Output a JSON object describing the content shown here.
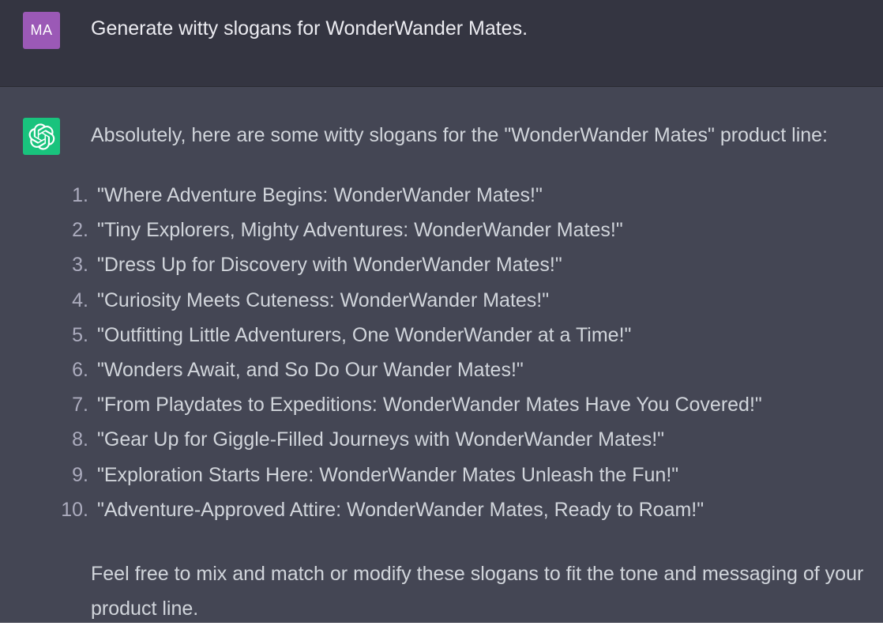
{
  "user_message": {
    "avatar_initials": "MA",
    "text": "Generate witty slogans for WonderWander Mates."
  },
  "assistant_message": {
    "avatar_icon": "openai-logo-icon",
    "intro": "Absolutely, here are some witty slogans for the \"WonderWander Mates\" product line:",
    "slogans": [
      {
        "num": "1.",
        "text": "\"Where Adventure Begins: WonderWander Mates!\""
      },
      {
        "num": "2.",
        "text": "\"Tiny Explorers, Mighty Adventures: WonderWander Mates!\""
      },
      {
        "num": "3.",
        "text": "\"Dress Up for Discovery with WonderWander Mates!\""
      },
      {
        "num": "4.",
        "text": "\"Curiosity Meets Cuteness: WonderWander Mates!\""
      },
      {
        "num": "5.",
        "text": "\"Outfitting Little Adventurers, One WonderWander at a Time!\""
      },
      {
        "num": "6.",
        "text": "\"Wonders Await, and So Do Our Wander Mates!\""
      },
      {
        "num": "7.",
        "text": "\"From Playdates to Expeditions: WonderWander Mates Have You Covered!\""
      },
      {
        "num": "8.",
        "text": "\"Gear Up for Giggle-Filled Journeys with WonderWander Mates!\""
      },
      {
        "num": "9.",
        "text": "\"Exploration Starts Here: WonderWander Mates Unleash the Fun!\""
      },
      {
        "num": "10.",
        "text": "\"Adventure-Approved Attire: WonderWander Mates, Ready to Roam!\""
      }
    ],
    "closing": "Feel free to mix and match or modify these slogans to fit the tone and messaging of your product line."
  },
  "colors": {
    "user_bg": "#343541",
    "assistant_bg": "#444654",
    "user_avatar": "#9b59b6",
    "bot_avatar": "#19c37d"
  }
}
